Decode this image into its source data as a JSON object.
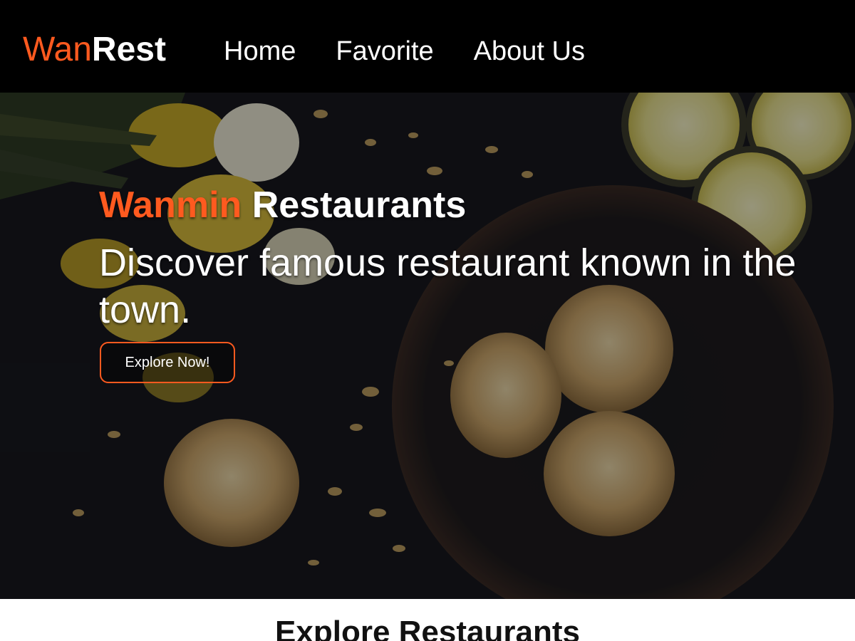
{
  "navbar": {
    "logo": {
      "light": "Wan",
      "bold": "Rest"
    },
    "links": [
      "Home",
      "Favorite",
      "About Us"
    ]
  },
  "hero": {
    "title_accent": "Wanmin",
    "title_rest": "Restaurants",
    "subtitle": "Discover famous restaurant known in the town.",
    "button_label": "Explore Now!"
  },
  "section": {
    "title": "Explore Restaurants"
  },
  "colors": {
    "accent": "#ff5a1f",
    "navbar_bg": "#000000",
    "hero_bg": "#15161c"
  }
}
